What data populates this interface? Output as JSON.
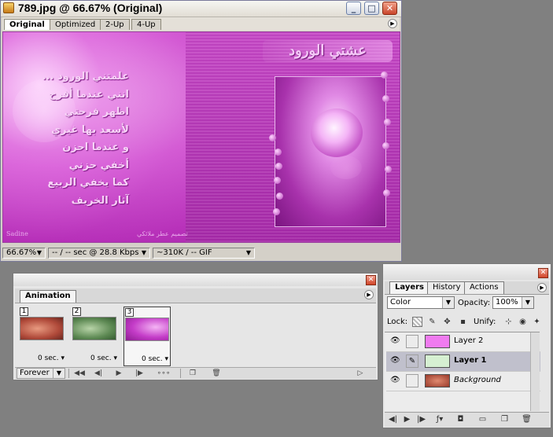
{
  "document": {
    "title": "789.jpg @ 66.67% (Original)",
    "controls": {
      "minimize": "_",
      "maximize": "□",
      "close": "✕"
    },
    "tabs": [
      "Original",
      "Optimized",
      "2-Up",
      "4-Up"
    ],
    "active_tab": "Original",
    "status": {
      "zoom": "66.67%",
      "download_time": "-- / -- sec @ 28.8 Kbps",
      "size": "~310K / -- GIF"
    },
    "image": {
      "banner": "عشتي الورود",
      "poem_lines": [
        "علمتني الورود ...",
        "انني عندما أفرح",
        "اظهر فرحتي",
        "لأسعد بها غيري",
        "و عندما احزن",
        "أخفي حزني",
        "كما يخفي الربيع",
        "آثار الخريف"
      ],
      "signature": "Sadine",
      "credit": "تصميم عطر ملائكي"
    }
  },
  "animation": {
    "tab": "Animation",
    "frames": [
      {
        "num": "1",
        "delay": "0 sec.",
        "selected": false
      },
      {
        "num": "2",
        "delay": "0 sec.",
        "selected": false
      },
      {
        "num": "3",
        "delay": "0 sec.",
        "selected": true
      }
    ],
    "loop": "Forever",
    "controls": [
      "first-frame",
      "previous-frame",
      "play",
      "next-frame",
      "tween",
      "duplicate-frame",
      "delete-frame"
    ]
  },
  "layers": {
    "tabs": [
      "Layers",
      "History",
      "Actions"
    ],
    "active_tab": "Layers",
    "blend_mode": "Color",
    "opacity_label": "Opacity:",
    "opacity": "100%",
    "lock_label": "Lock:",
    "unify_label": "Unify:",
    "items": [
      {
        "name": "Layer 2",
        "selected": false,
        "locked": false,
        "thumb_color": "#f07bf0"
      },
      {
        "name": "Layer 1",
        "selected": true,
        "locked": false,
        "thumb_color": "#d6f0d2"
      },
      {
        "name": "Background",
        "selected": false,
        "locked": true,
        "thumb_color": "#b6503a"
      }
    ]
  },
  "colors": {
    "accent_pink": "#c63fc8",
    "window_face": "#d4d0c8",
    "desktop": "#808080"
  }
}
